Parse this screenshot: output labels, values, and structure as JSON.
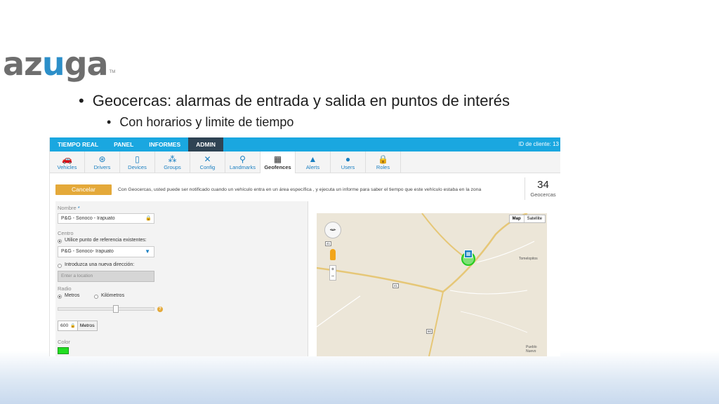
{
  "logo": {
    "brand": "azuga",
    "prefix": "az",
    "u": "u",
    "suffix": "ga",
    "tm": "TM"
  },
  "slide": {
    "bullet1": "Geocercas: alarmas de entrada y salida en puntos de interés",
    "bullet2": "Con horarios y limite de tiempo"
  },
  "topnav": {
    "items": [
      {
        "label": "TIEMPO REAL"
      },
      {
        "label": "PANEL"
      },
      {
        "label": "INFORMES"
      },
      {
        "label": "ADMIN",
        "active": true
      }
    ],
    "client_id": "ID de cliente: 13"
  },
  "iconbar": {
    "tabs": [
      {
        "label": "Vehicles",
        "icon": "car-icon",
        "glyph": "🚗"
      },
      {
        "label": "Drivers",
        "icon": "steering-wheel-icon",
        "glyph": "⊛"
      },
      {
        "label": "Devices",
        "icon": "device-icon",
        "glyph": "▯"
      },
      {
        "label": "Groups",
        "icon": "groups-icon",
        "glyph": "⁂"
      },
      {
        "label": "Config",
        "icon": "tools-icon",
        "glyph": "✕"
      },
      {
        "label": "Landmarks",
        "icon": "pin-icon",
        "glyph": "⚲"
      },
      {
        "label": "Geofences",
        "icon": "fence-icon",
        "glyph": "▦",
        "active": true
      },
      {
        "label": "Alerts",
        "icon": "warning-icon",
        "glyph": "▲"
      },
      {
        "label": "Users",
        "icon": "user-icon",
        "glyph": "●"
      },
      {
        "label": "Roles",
        "icon": "lock-icon",
        "glyph": "🔒"
      }
    ]
  },
  "header": {
    "cancel_label": "Cancelar",
    "message": "Con Geocercas, usted puede ser notificado cuando un vehículo entra en un área específica , y ejecuta un informe para saber el tiempo que este vehículo estaba en la zona",
    "count": "34",
    "count_label": "Geocercas"
  },
  "form": {
    "name_label": "Nombre",
    "required_mark": "*",
    "name_value": "P&G - Sonoco - Irapuato",
    "centro_label": "Centro",
    "opt_existing": "Utilice punto de referencia existentes:",
    "existing_value": "P&G - Sonoco- Irapuato",
    "opt_new": "Introduzca una nueva dirección:",
    "location_placeholder": "Enter a location",
    "radio_label": "Radio",
    "unit_meters": "Metros",
    "unit_km": "Kilómetros",
    "help": "?",
    "radius_value": "600",
    "radius_unit": "Metros",
    "radius_slider_fraction": 0.6,
    "color_label": "Color",
    "color_value": "#22dd22"
  },
  "map": {
    "type_map": "Map",
    "type_satellite": "Satellite",
    "zoom_in": "+",
    "zoom_out": "−",
    "places": {
      "tomelopitos": "Tomelopitos",
      "pueblo_nuevo": "Pueblo Nuevo"
    },
    "roads": {
      "r41a": "41",
      "r41b": "41",
      "r90": "90"
    }
  }
}
